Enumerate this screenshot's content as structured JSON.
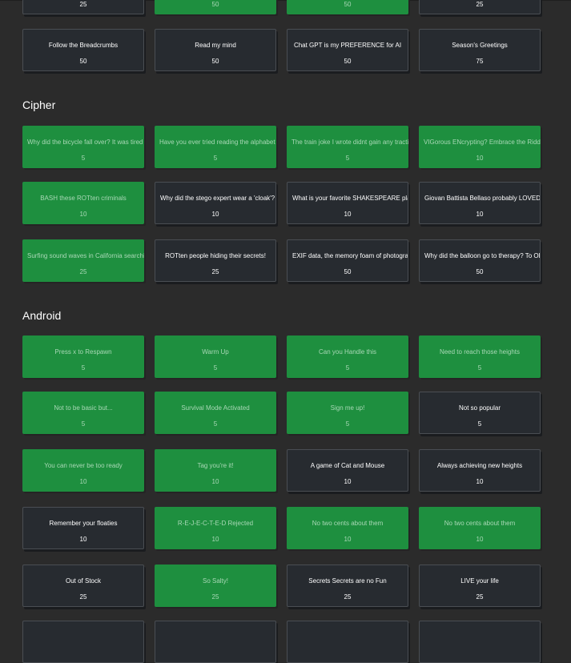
{
  "rows_top": [
    {
      "label": "",
      "value": "25",
      "state": "open"
    },
    {
      "label": "",
      "value": "50",
      "state": "solved"
    },
    {
      "label": "",
      "value": "50",
      "state": "solved"
    },
    {
      "label": "",
      "value": "25",
      "state": "open"
    }
  ],
  "misc": [
    {
      "label": "Follow the Breadcrumbs",
      "value": "50",
      "state": "open"
    },
    {
      "label": "Read my mind",
      "value": "50",
      "state": "open"
    },
    {
      "label": "Chat GPT is my PREFERENCE for AI",
      "value": "50",
      "state": "open"
    },
    {
      "label": "Season's Greetings",
      "value": "75",
      "state": "open"
    }
  ],
  "cipher": {
    "title": "Cipher",
    "cards": [
      {
        "label": "Why did the bicycle fall over? It was tired o",
        "value": "5",
        "state": "solved"
      },
      {
        "label": "Have you ever tried reading the alphabet in",
        "value": "5",
        "state": "solved"
      },
      {
        "label": "The train joke I wrote didnt gain any tractio",
        "value": "5",
        "state": "solved"
      },
      {
        "label": "VIGorous ENcrypting? Embrace the Riddle",
        "value": "10",
        "state": "solved"
      },
      {
        "label": "BASH these ROTten criminals",
        "value": "10",
        "state": "solved"
      },
      {
        "label": "Why did the stego expert wear a 'cloak'? To",
        "value": "10",
        "state": "open"
      },
      {
        "label": "What is your favorite SHAKESPEARE play",
        "value": "10",
        "state": "open"
      },
      {
        "label": "Giovan Battista Bellaso probably LOVED p",
        "value": "10",
        "state": "open"
      },
      {
        "label": "Surfing sound waves in California searchin",
        "value": "25",
        "state": "solved"
      },
      {
        "label": "ROTten people hiding their secrets!",
        "value": "25",
        "state": "open"
      },
      {
        "label": "EXIF data, the memory foam of photograp",
        "value": "50",
        "state": "open"
      },
      {
        "label": "Why did the balloon go to therapy? To OPE",
        "value": "50",
        "state": "open"
      }
    ]
  },
  "android": {
    "title": "Android",
    "cards": [
      {
        "label": "Press x to Respawn",
        "value": "5",
        "state": "solved"
      },
      {
        "label": "Warm Up",
        "value": "5",
        "state": "solved"
      },
      {
        "label": "Can you Handle this",
        "value": "5",
        "state": "solved"
      },
      {
        "label": "Need to reach those heights",
        "value": "5",
        "state": "solved"
      },
      {
        "label": "Not to be basic but...",
        "value": "5",
        "state": "solved"
      },
      {
        "label": "Survival Mode Activated",
        "value": "5",
        "state": "solved"
      },
      {
        "label": "Sign me up!",
        "value": "5",
        "state": "solved"
      },
      {
        "label": "Not so popular",
        "value": "5",
        "state": "open"
      },
      {
        "label": "You can never be too ready",
        "value": "10",
        "state": "solved"
      },
      {
        "label": "Tag you're it!",
        "value": "10",
        "state": "solved"
      },
      {
        "label": "A game of Cat and Mouse",
        "value": "10",
        "state": "open"
      },
      {
        "label": "Always achieving new heights",
        "value": "10",
        "state": "open"
      },
      {
        "label": "Remember your floaties",
        "value": "10",
        "state": "open"
      },
      {
        "label": "R-E-J-E-C-T-E-D Rejected",
        "value": "10",
        "state": "solved"
      },
      {
        "label": "No two cents about them",
        "value": "10",
        "state": "solved"
      },
      {
        "label": "No two cents about them",
        "value": "10",
        "state": "solved"
      },
      {
        "label": "Out of Stock",
        "value": "25",
        "state": "open"
      },
      {
        "label": "So Salty!",
        "value": "25",
        "state": "solved"
      },
      {
        "label": "Secrets Secrets are no Fun",
        "value": "25",
        "state": "open"
      },
      {
        "label": "LIVE your life",
        "value": "25",
        "state": "open"
      }
    ]
  },
  "colors": {
    "solved": "#1e8f3f",
    "open": "#272b30",
    "background": "#2b2b2b"
  }
}
